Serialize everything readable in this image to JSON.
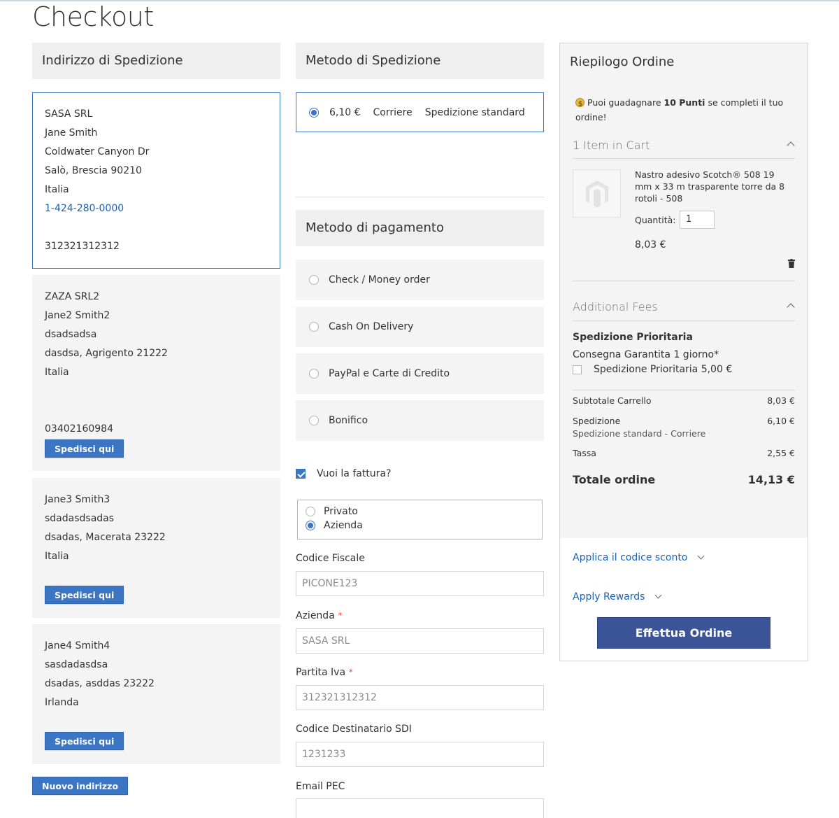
{
  "page": {
    "title": "Checkout"
  },
  "shipping_address": {
    "header": "Indirizzo di Spedizione",
    "addresses": [
      {
        "lines": [
          "SASA SRL",
          "Jane Smith",
          "Coldwater Canyon Dr",
          "Salò, Brescia 90210",
          "Italia"
        ],
        "phone": "1-424-280-0000",
        "vat": "312321312312",
        "selected": true
      },
      {
        "lines": [
          "ZAZA SRL2",
          "Jane2 Smith2",
          "dsadsadsa",
          "dasdsa, Agrigento 21222",
          "Italia"
        ],
        "vat": "03402160984",
        "button": "Spedisci qui"
      },
      {
        "lines": [
          "Jane3 Smith3",
          "sdadasdsadas",
          "dsadas, Macerata 23222",
          "Italia"
        ],
        "button": "Spedisci qui"
      },
      {
        "lines": [
          "Jane4 Smith4",
          "sasdadasdsa",
          "dsadas, asddas 23222",
          "Irlanda"
        ],
        "button": "Spedisci qui"
      }
    ],
    "new_address_button": "Nuovo indirizzo"
  },
  "shipping_method": {
    "header": "Metodo di Spedizione",
    "option": {
      "price": "6,10 €",
      "carrier": "Corriere",
      "method": "Spedizione standard",
      "selected": true
    }
  },
  "payment": {
    "header": "Metodo di pagamento",
    "options": [
      "Check / Money order",
      "Cash On Delivery",
      "PayPal e Carte di Credito",
      "Bonifico"
    ],
    "invoice_label": "Vuoi la fattura?",
    "invoice_checked": true,
    "customer_types": [
      "Privato",
      "Azienda"
    ],
    "customer_type_selected": "Azienda",
    "fields": {
      "codice_fiscale": {
        "label": "Codice Fiscale",
        "placeholder": "PICONE123"
      },
      "azienda": {
        "label": "Azienda",
        "required": "*",
        "placeholder": "SASA SRL"
      },
      "partita_iva": {
        "label": "Partita Iva",
        "required": "*",
        "placeholder": "312321312312"
      },
      "sdi": {
        "label": "Codice Destinatario SDI",
        "placeholder": "1231233"
      },
      "pec": {
        "label": "Email PEC",
        "placeholder": ""
      }
    }
  },
  "summary": {
    "title": "Riepilogo Ordine",
    "points_prefix": "Puoi guadagnare ",
    "points_bold": "10 Punti",
    "points_suffix": " se completi il tuo ordine!",
    "cart_label": "1 Item in Cart",
    "item": {
      "name": "Nastro adesivo Scotch® 508 19 mm x 33 m trasparente torre da 8 rotoli - 508",
      "qty_label": "Quantità:",
      "qty": "1",
      "price": "8,03 €"
    },
    "fees_label": "Additional Fees",
    "fee_title": "Spedizione Prioritaria",
    "fee_desc": "Consegna Garantita 1 giorno*",
    "fee_option": "Spedizione Prioritaria 5,00 €",
    "subtotal_label": "Subtotale Carrello",
    "subtotal": "8,03 €",
    "shipping_label": "Spedizione",
    "shipping": "6,10 €",
    "shipping_sub": "Spedizione standard - Corriere",
    "tax_label": "Tassa",
    "tax": "2,55 €",
    "total_label": "Totale ordine",
    "total": "14,13 €",
    "discount_link": "Applica il codice sconto",
    "rewards_link": "Apply Rewards",
    "order_button": "Effettua Ordine"
  },
  "colors": {
    "accent": "#3b75c4",
    "order_button": "#3a5497",
    "link": "#1a62b5"
  }
}
